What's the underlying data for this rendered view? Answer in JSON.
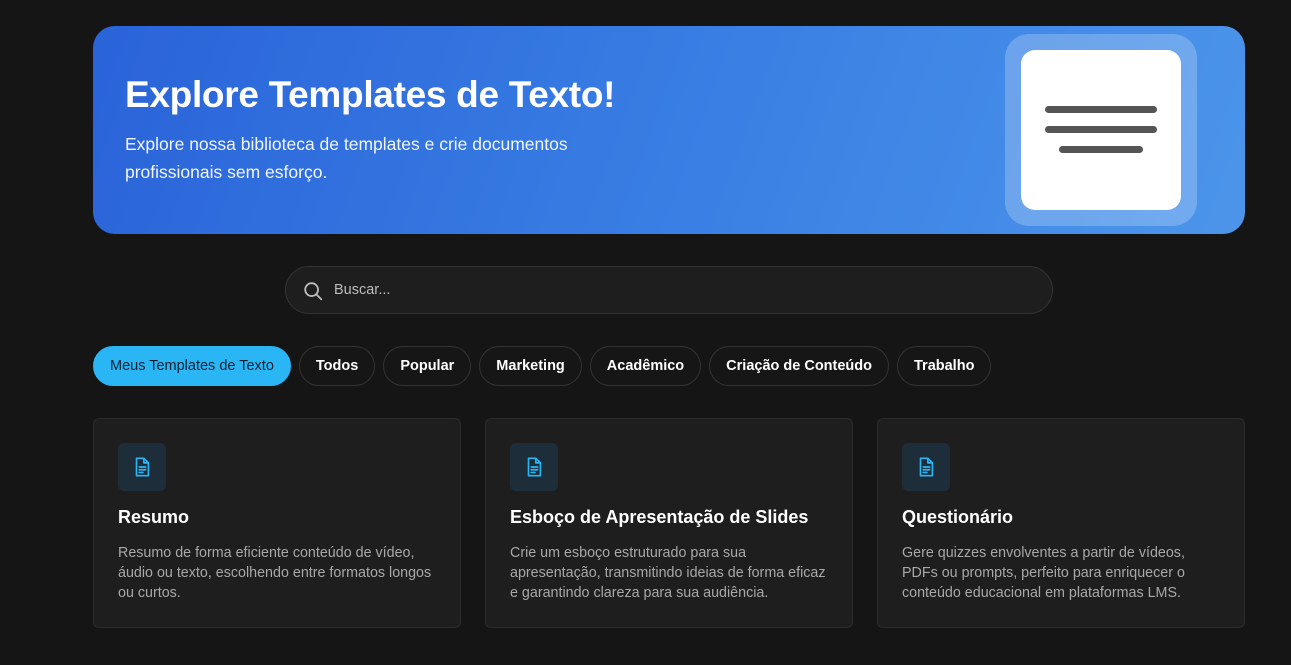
{
  "hero": {
    "title": "Explore Templates de Texto!",
    "subtitle": "Explore nossa biblioteca de templates e crie documentos profissionais sem esforço."
  },
  "search": {
    "placeholder": "Buscar...",
    "value": ""
  },
  "filters": [
    {
      "label": "Meus Templates de Texto",
      "active": true
    },
    {
      "label": "Todos",
      "active": false
    },
    {
      "label": "Popular",
      "active": false
    },
    {
      "label": "Marketing",
      "active": false
    },
    {
      "label": "Acadêmico",
      "active": false
    },
    {
      "label": "Criação de Conteúdo",
      "active": false
    },
    {
      "label": "Trabalho",
      "active": false
    }
  ],
  "cards": [
    {
      "title": "Resumo",
      "description": "Resumo de forma eficiente conteúdo de vídeo, áudio ou texto, escolhendo entre formatos longos ou curtos.",
      "icon": "document-icon"
    },
    {
      "title": "Esboço de Apresentação de Slides",
      "description": "Crie um esboço estruturado para sua apresentação, transmitindo ideias de forma eficaz e garantindo clareza para sua audiência.",
      "icon": "document-icon"
    },
    {
      "title": "Questionário",
      "description": "Gere quizzes envolventes a partir de vídeos, PDFs ou prompts, perfeito para enriquecer o conteúdo educacional em plataformas LMS.",
      "icon": "document-icon"
    }
  ],
  "colors": {
    "background": "#151515",
    "accent": "#2ab5f5",
    "hero_start": "#2a63d9",
    "hero_end": "#4c95ea",
    "card_bg": "#1e1e1e"
  }
}
